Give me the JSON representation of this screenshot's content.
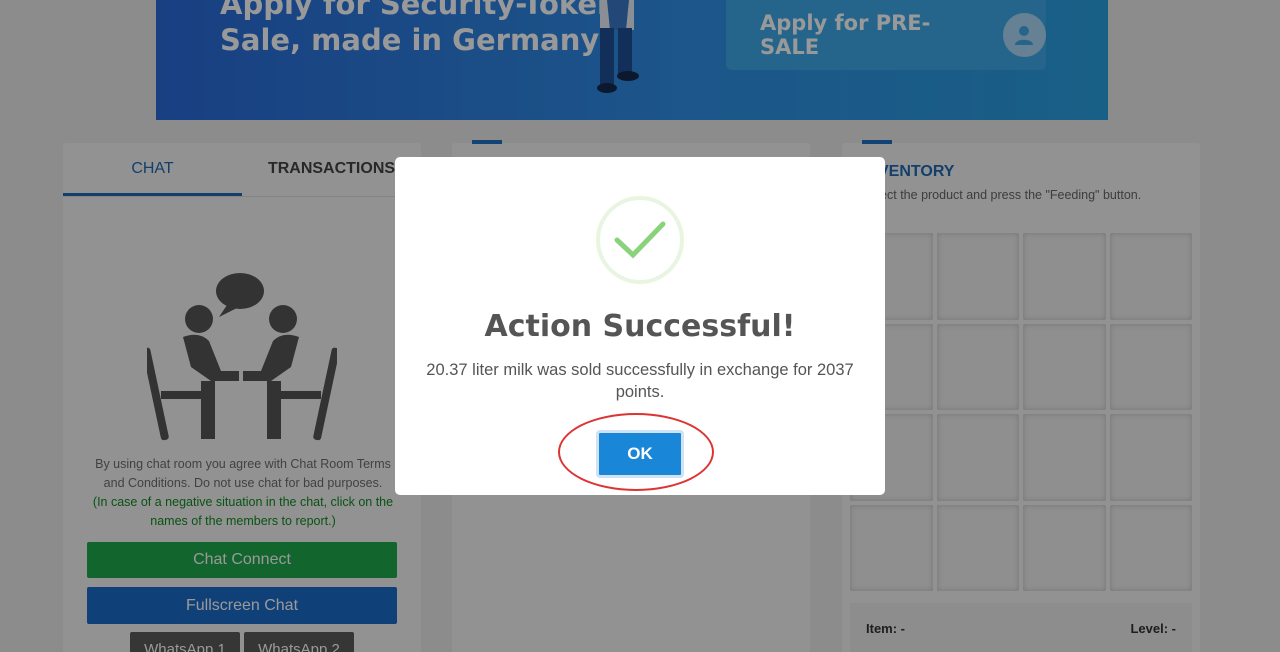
{
  "banner": {
    "headline_line1": "Apply for Security-Token-",
    "headline_line2": "Sale, made in Germany!",
    "presale_button": "Apply for PRE-SALE"
  },
  "chat_panel": {
    "tabs": [
      {
        "label": "CHAT",
        "active": true
      },
      {
        "label": "TRANSACTIONS",
        "active": false
      }
    ],
    "terms_text": "By using chat room you agree with Chat Room Terms and Conditions. Do not use chat for bad purposes.",
    "warning_text": "(In case of a negative situation in the chat, click on the names of the members to report.)",
    "chat_connect": "Chat Connect",
    "fullscreen_chat": "Fullscreen Chat",
    "whatsapp1": "WhatsApp 1",
    "whatsapp2": "WhatsApp 2"
  },
  "inventory": {
    "title": "INVENTORY",
    "subtitle": "Select the product and press the \"Feeding\" button.",
    "item_label": "Item: -",
    "level_label": "Level: -"
  },
  "modal": {
    "title": "Action Successful!",
    "message": "20.37 liter milk was sold successfully in exchange for 2037 points.",
    "ok_label": "OK"
  },
  "colors": {
    "accent_blue": "#1e6ab5",
    "success_green": "#8bd27c",
    "chat_connect_green": "#1fa84a",
    "highlight_red": "#d33333"
  }
}
